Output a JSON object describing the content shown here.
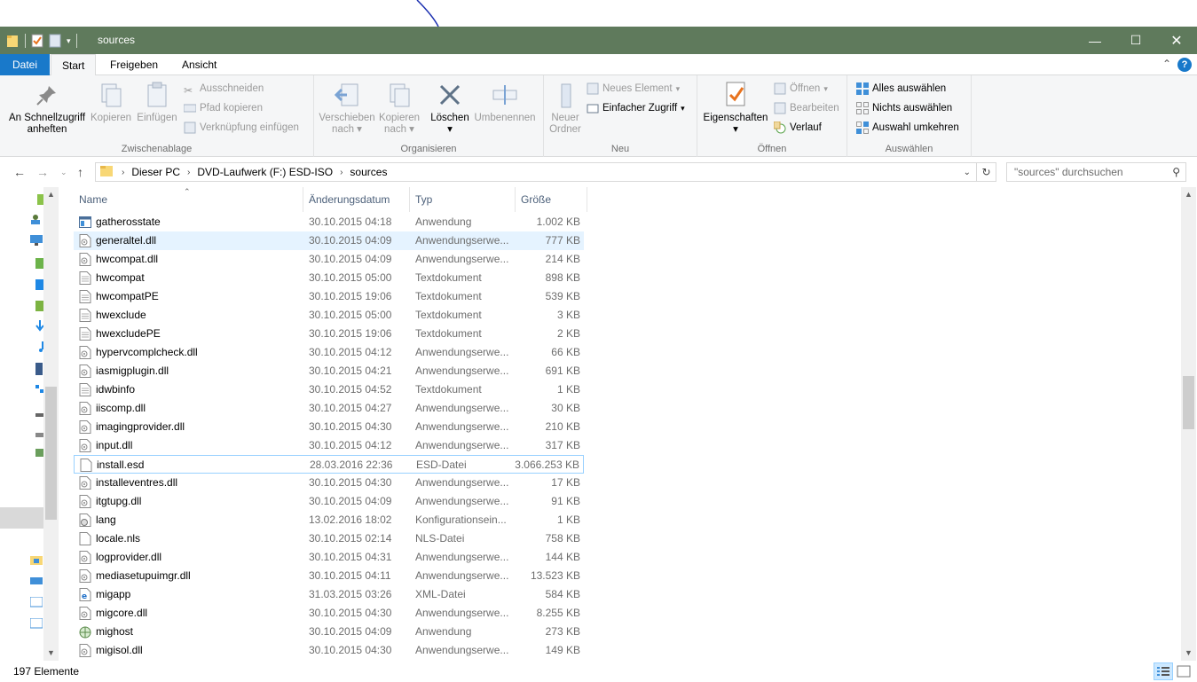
{
  "window": {
    "title": "sources",
    "colors": {
      "titlebar": "#5f7a5c",
      "accent": "#1979ca",
      "selection": "#e5f3ff"
    }
  },
  "tabs": [
    {
      "label": "Datei"
    },
    {
      "label": "Start"
    },
    {
      "label": "Freigeben"
    },
    {
      "label": "Ansicht"
    }
  ],
  "ribbon": {
    "clipboard": {
      "label": "Zwischenablage",
      "pin_l1": "An Schnellzugriff",
      "pin_l2": "anheften",
      "copy": "Kopieren",
      "paste": "Einfügen",
      "cut": "Ausschneiden",
      "copy_path": "Pfad kopieren",
      "paste_shortcut": "Verknüpfung einfügen"
    },
    "organize": {
      "label": "Organisieren",
      "move_l1": "Verschieben",
      "move_l2": "nach",
      "copy_l1": "Kopieren",
      "copy_l2": "nach",
      "delete": "Löschen",
      "rename": "Umbenennen"
    },
    "new": {
      "label": "Neu",
      "folder_l1": "Neuer",
      "folder_l2": "Ordner",
      "new_item": "Neues Element",
      "easy_access": "Einfacher Zugriff"
    },
    "open": {
      "label": "Öffnen",
      "properties": "Eigenschaften",
      "open": "Öffnen",
      "edit": "Bearbeiten",
      "history": "Verlauf"
    },
    "select": {
      "label": "Auswählen",
      "all": "Alles auswählen",
      "none": "Nichts auswählen",
      "invert": "Auswahl umkehren"
    }
  },
  "address": {
    "crumbs": [
      "Dieser PC",
      "DVD-Laufwerk (F:) ESD-ISO",
      "sources"
    ],
    "search_placeholder": "\"sources\" durchsuchen"
  },
  "columns": {
    "name": "Name",
    "date": "Änderungsdatum",
    "type": "Typ",
    "size": "Größe"
  },
  "files": [
    {
      "name": "gatherosstate",
      "date": "30.10.2015 04:18",
      "type": "Anwendung",
      "size": "1.002 KB",
      "icon": "app-icon"
    },
    {
      "name": "generaltel.dll",
      "date": "30.10.2015 04:09",
      "type": "Anwendungserwe...",
      "size": "777 KB",
      "icon": "dll-icon"
    },
    {
      "name": "hwcompat.dll",
      "date": "30.10.2015 04:09",
      "type": "Anwendungserwe...",
      "size": "214 KB",
      "icon": "dll-icon"
    },
    {
      "name": "hwcompat",
      "date": "30.10.2015 05:00",
      "type": "Textdokument",
      "size": "898 KB",
      "icon": "text-icon"
    },
    {
      "name": "hwcompatPE",
      "date": "30.10.2015 19:06",
      "type": "Textdokument",
      "size": "539 KB",
      "icon": "text-icon"
    },
    {
      "name": "hwexclude",
      "date": "30.10.2015 05:00",
      "type": "Textdokument",
      "size": "3 KB",
      "icon": "text-icon"
    },
    {
      "name": "hwexcludePE",
      "date": "30.10.2015 19:06",
      "type": "Textdokument",
      "size": "2 KB",
      "icon": "text-icon"
    },
    {
      "name": "hypervcomplcheck.dll",
      "date": "30.10.2015 04:12",
      "type": "Anwendungserwe...",
      "size": "66 KB",
      "icon": "dll-icon"
    },
    {
      "name": "iasmigplugin.dll",
      "date": "30.10.2015 04:21",
      "type": "Anwendungserwe...",
      "size": "691 KB",
      "icon": "dll-icon"
    },
    {
      "name": "idwbinfo",
      "date": "30.10.2015 04:52",
      "type": "Textdokument",
      "size": "1 KB",
      "icon": "text-icon"
    },
    {
      "name": "iiscomp.dll",
      "date": "30.10.2015 04:27",
      "type": "Anwendungserwe...",
      "size": "30 KB",
      "icon": "dll-icon"
    },
    {
      "name": "imagingprovider.dll",
      "date": "30.10.2015 04:30",
      "type": "Anwendungserwe...",
      "size": "210 KB",
      "icon": "dll-icon"
    },
    {
      "name": "input.dll",
      "date": "30.10.2015 04:12",
      "type": "Anwendungserwe...",
      "size": "317 KB",
      "icon": "dll-icon"
    },
    {
      "name": "install.esd",
      "date": "28.03.2016 22:36",
      "type": "ESD-Datei",
      "size": "3.066.253 KB",
      "icon": "blank-file-icon"
    },
    {
      "name": "installeventres.dll",
      "date": "30.10.2015 04:30",
      "type": "Anwendungserwe...",
      "size": "17 KB",
      "icon": "dll-icon"
    },
    {
      "name": "itgtupg.dll",
      "date": "30.10.2015 04:09",
      "type": "Anwendungserwe...",
      "size": "91 KB",
      "icon": "dll-icon"
    },
    {
      "name": "lang",
      "date": "13.02.2016 18:02",
      "type": "Konfigurationsein...",
      "size": "1 KB",
      "icon": "config-icon"
    },
    {
      "name": "locale.nls",
      "date": "30.10.2015 02:14",
      "type": "NLS-Datei",
      "size": "758 KB",
      "icon": "blank-file-icon"
    },
    {
      "name": "logprovider.dll",
      "date": "30.10.2015 04:31",
      "type": "Anwendungserwe...",
      "size": "144 KB",
      "icon": "dll-icon"
    },
    {
      "name": "mediasetupuimgr.dll",
      "date": "30.10.2015 04:11",
      "type": "Anwendungserwe...",
      "size": "13.523 KB",
      "icon": "dll-icon"
    },
    {
      "name": "migapp",
      "date": "31.03.2015 03:26",
      "type": "XML-Datei",
      "size": "584 KB",
      "icon": "xml-icon"
    },
    {
      "name": "migcore.dll",
      "date": "30.10.2015 04:30",
      "type": "Anwendungserwe...",
      "size": "8.255 KB",
      "icon": "dll-icon"
    },
    {
      "name": "mighost",
      "date": "30.10.2015 04:09",
      "type": "Anwendung",
      "size": "273 KB",
      "icon": "app-globe-icon"
    },
    {
      "name": "migisol.dll",
      "date": "30.10.2015 04:30",
      "type": "Anwendungserwe...",
      "size": "149 KB",
      "icon": "dll-icon"
    }
  ],
  "status": {
    "count": "197 Elemente"
  }
}
